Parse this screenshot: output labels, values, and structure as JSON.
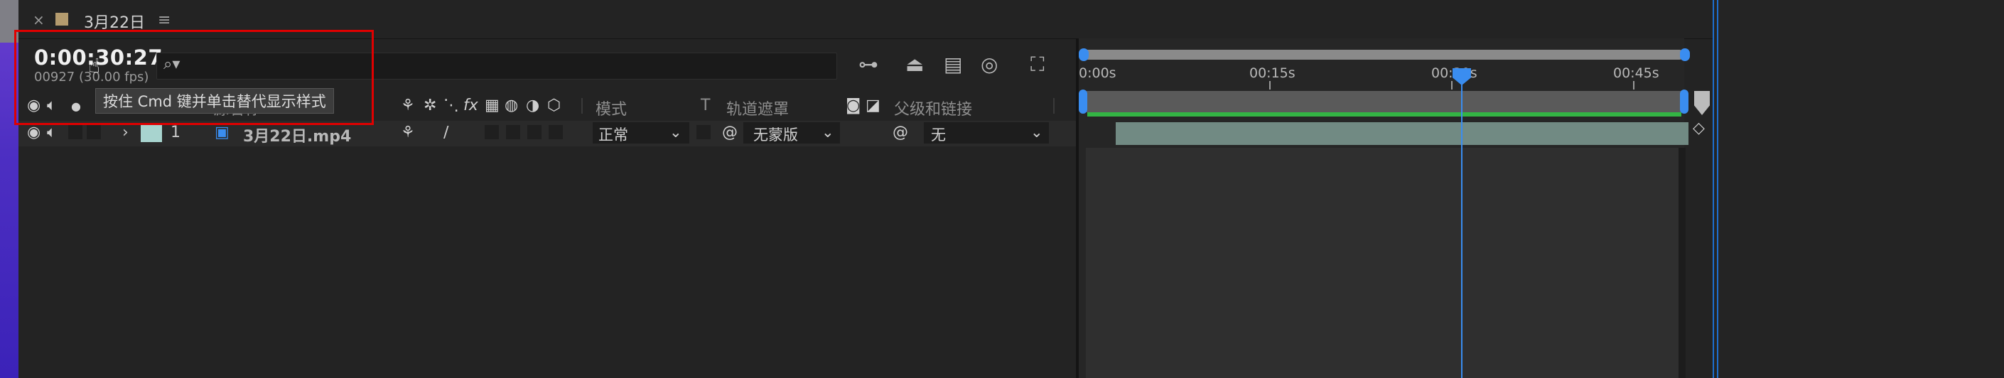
{
  "window": {
    "tab_close": "×",
    "tab_title": "3月22日",
    "tab_menu": "≡",
    "comp_swatch_color": "#b49b6e"
  },
  "time": {
    "current": "0:00:30:27",
    "frames": "00927 (30.00 fps)"
  },
  "search": {
    "placeholder": ""
  },
  "toolbar_icons": [
    "composition-flowchart-icon",
    "draft-3d-icon",
    "frame-blending-icon",
    "motion-blur-icon",
    "graph-editor-icon"
  ],
  "columns": {
    "source_name": "源名称",
    "mode": "模式",
    "track_t": "T",
    "track_matte": "轨道遮罩",
    "parent": "父级和链接"
  },
  "switch_icons": [
    "shy-icon",
    "collapse-icon",
    "quality-icon",
    "fx-icon",
    "frame-blend-icon",
    "motion-blur-icon",
    "adjustment-icon",
    "3d-layer-icon"
  ],
  "tooltip": "按住 Cmd 键并单击替代显示样式",
  "layers": [
    {
      "index": "1",
      "name": "3月22日.mp4",
      "label_color": "#a8d4cf",
      "mode": "正常",
      "matte": "无蒙版",
      "parent": "无"
    }
  ],
  "ruler": {
    "labels": [
      "0:00s",
      "00:15s",
      "00:30s",
      "00:45s"
    ]
  },
  "colors": {
    "accent": "#3a8df0",
    "highlight_box": "#e00000",
    "work_area_green": "#33b444",
    "layer_bar": "#718a83"
  }
}
